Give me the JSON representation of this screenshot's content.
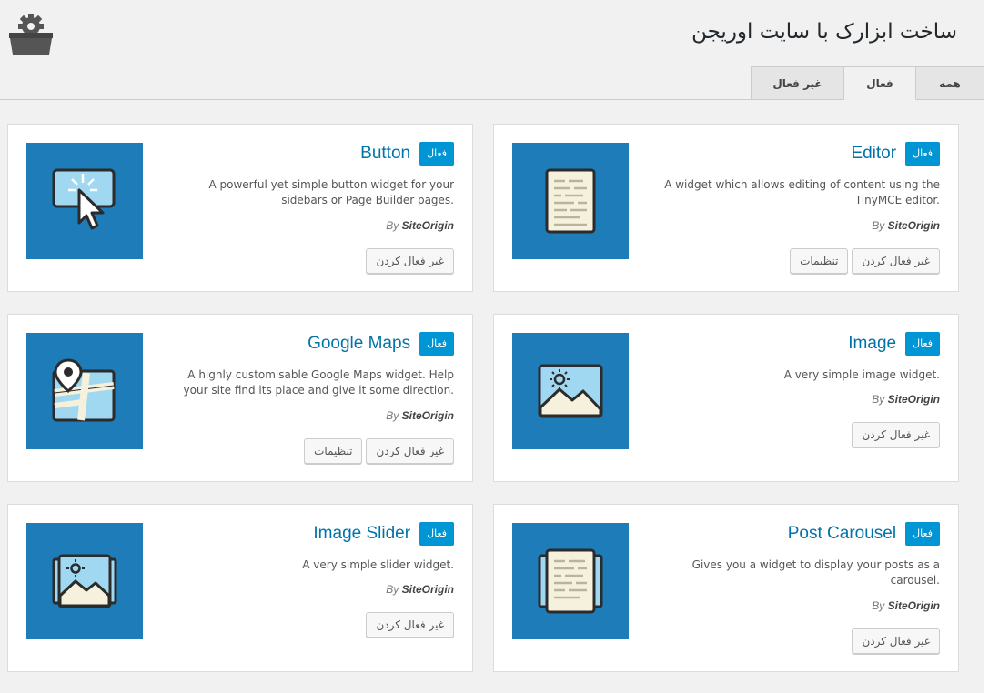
{
  "header": {
    "title": "ساخت ابزارک با سایت اوریجن",
    "logo_icon": "toolbox-gear-icon"
  },
  "tabs": [
    {
      "label": "همه",
      "active": false
    },
    {
      "label": "فعال",
      "active": true
    },
    {
      "label": "غیر فعال",
      "active": false
    }
  ],
  "widgets": [
    {
      "title": "Editor",
      "badge": "فعال",
      "description": "A widget which allows editing of content using the TinyMCE editor.",
      "by_prefix": "By",
      "author": "SiteOrigin",
      "deactivate_label": "غیر فعال کردن",
      "settings_label": "تنظیمات",
      "icon": "editor-document-icon"
    },
    {
      "title": "Button",
      "badge": "فعال",
      "description": "A powerful yet simple button widget for your sidebars or Page Builder pages.",
      "by_prefix": "By",
      "author": "SiteOrigin",
      "deactivate_label": "غیر فعال کردن",
      "icon": "button-click-icon"
    },
    {
      "title": "Image",
      "badge": "فعال",
      "description": "A very simple image widget.",
      "by_prefix": "By",
      "author": "SiteOrigin",
      "deactivate_label": "غیر فعال کردن",
      "icon": "image-icon"
    },
    {
      "title": "Google Maps",
      "badge": "فعال",
      "description": "A highly customisable Google Maps widget. Help your site find its place and give it some direction.",
      "by_prefix": "By",
      "author": "SiteOrigin",
      "deactivate_label": "غیر فعال کردن",
      "settings_label": "تنظیمات",
      "icon": "map-pin-icon"
    },
    {
      "title": "Post Carousel",
      "badge": "فعال",
      "description": "Gives you a widget to display your posts as a carousel.",
      "by_prefix": "By",
      "author": "SiteOrigin",
      "deactivate_label": "غیر فعال کردن",
      "icon": "post-carousel-icon"
    },
    {
      "title": "Image Slider",
      "badge": "فعال",
      "description": "A very simple slider widget.",
      "by_prefix": "By",
      "author": "SiteOrigin",
      "deactivate_label": "غیر فعال کردن",
      "icon": "image-slider-icon"
    }
  ],
  "colors": {
    "accent": "#0096d6",
    "icon_bg": "#1e7db8",
    "title_link": "#0073aa"
  }
}
